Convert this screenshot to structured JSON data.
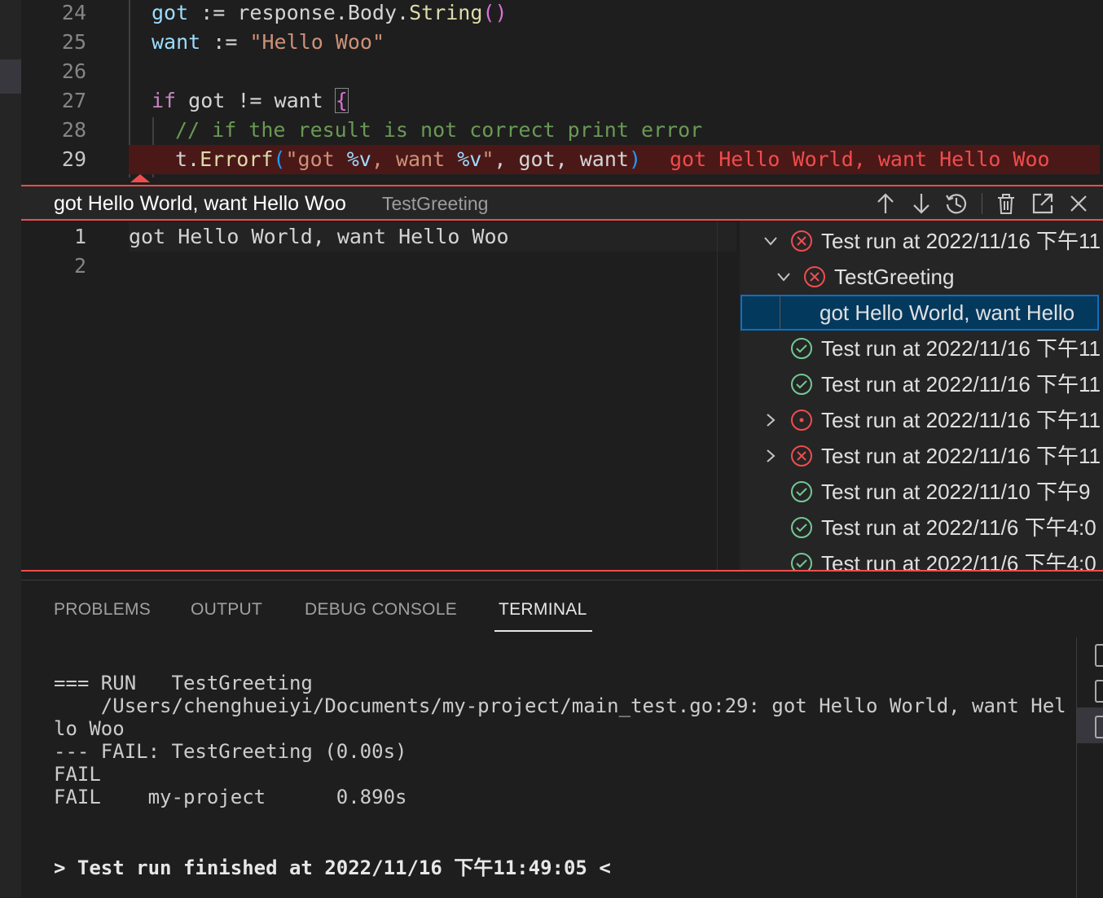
{
  "editor": {
    "lines": [
      {
        "num": "24"
      },
      {
        "num": "25"
      },
      {
        "num": "26"
      },
      {
        "num": "27"
      },
      {
        "num": "28"
      },
      {
        "num": "29"
      }
    ],
    "code": {
      "l24": {
        "a": "got",
        "b": " := response.Body.",
        "c": "String",
        "d": "()"
      },
      "l25": {
        "a": "want",
        "b": " := ",
        "c": "\"Hello Woo\""
      },
      "l27": {
        "a": "if",
        "b": " got != want ",
        "c": "{"
      },
      "l28": {
        "a": "// if the result is not correct print error"
      },
      "l29": {
        "a": "t.",
        "b": "Errorf",
        "c": "(",
        "d": "\"got ",
        "e": "%v",
        "f": ", want ",
        "g": "%v",
        "h": "\"",
        "i": ", got, want",
        "j": ")"
      }
    },
    "inline_error": "got Hello World, want Hello Woo"
  },
  "peek": {
    "title": "got Hello World, want Hello Woo",
    "subtitle": "TestGreeting",
    "actions": [
      "arrow-up-icon",
      "arrow-down-icon",
      "history-icon",
      "trash-icon",
      "open-external-icon",
      "close-icon"
    ],
    "line_numbers": [
      "1",
      "2"
    ],
    "message": "got Hello World, want Hello Woo",
    "tree": [
      {
        "label": "Test run at 2022/11/16 下午11",
        "status": "failed",
        "expanded": true
      },
      {
        "label": "TestGreeting",
        "status": "failed",
        "expanded": true
      },
      {
        "label": "got Hello World, want Hello",
        "status": "message",
        "selected": true
      },
      {
        "label": "Test run at 2022/11/16 下午11",
        "status": "passed"
      },
      {
        "label": "Test run at 2022/11/16 下午11",
        "status": "passed"
      },
      {
        "label": "Test run at 2022/11/16 下午11",
        "status": "running",
        "expanded": false
      },
      {
        "label": "Test run at 2022/11/16 下午11",
        "status": "failed",
        "expanded": false
      },
      {
        "label": "Test run at 2022/11/10 下午9",
        "status": "passed"
      },
      {
        "label": "Test run at 2022/11/6 下午4:0",
        "status": "passed"
      },
      {
        "label": "Test run at 2022/11/6 下午4:0",
        "status": "passed"
      }
    ]
  },
  "panel": {
    "tabs": [
      "PROBLEMS",
      "OUTPUT",
      "DEBUG CONSOLE",
      "TERMINAL"
    ],
    "active_tab": "TERMINAL",
    "terminal": {
      "line1": "=== RUN   TestGreeting",
      "line2": "    /Users/chenghueiyi/Documents/my-project/main_test.go:29: got Hello World, want Hel",
      "line3": "lo Woo",
      "line4": "--- FAIL: TestGreeting (0.00s)",
      "line5": "FAIL",
      "line6": "FAIL    my-project      0.890s",
      "finish": "> Test run finished at 2022/11/16 下午11:49:05 <"
    }
  },
  "colors": {
    "error": "#f14c4c",
    "passed": "#73c991",
    "selection": "#04395e",
    "focus_border": "#0e70c0"
  }
}
